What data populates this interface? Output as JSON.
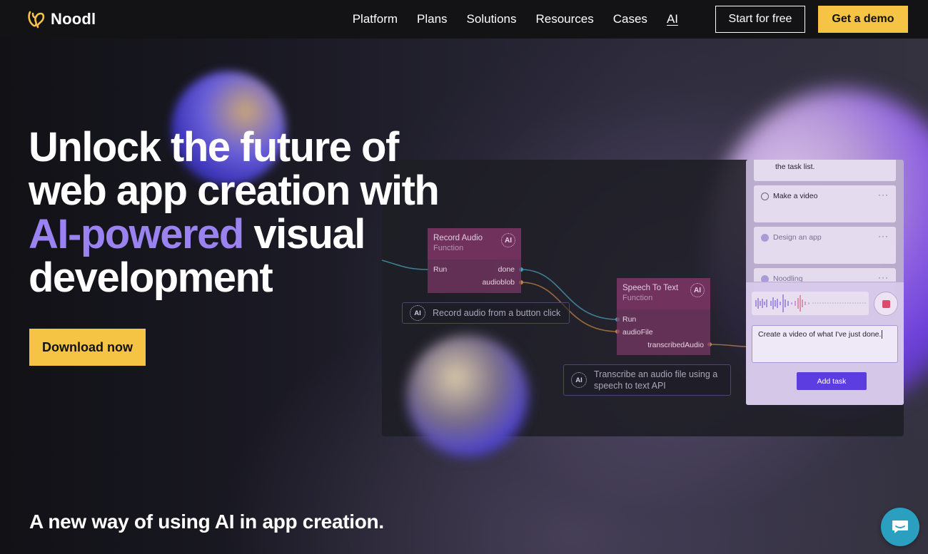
{
  "brand": {
    "name": "Noodl",
    "logo_color": "#f6c445"
  },
  "nav": {
    "links": [
      "Platform",
      "Plans",
      "Solutions",
      "Resources",
      "Cases",
      "AI"
    ],
    "start_label": "Start for free",
    "demo_label": "Get a demo"
  },
  "hero": {
    "line1_a": "Unlock ",
    "line1_b": "the future of",
    "line2": "web app creation with",
    "line3_accent": "AI-powered",
    "line3_rest": " visual",
    "line4": "development",
    "cta_label": "Download now",
    "tagline": "A new way of using AI in app creation."
  },
  "editor": {
    "node_record": {
      "title": "Record Audio",
      "subtitle": "Function",
      "badge": "AI",
      "port_run": "Run",
      "port_done": "done",
      "port_audioblob": "audioblob"
    },
    "node_speech": {
      "title": "Speech To Text",
      "subtitle": "Function",
      "badge": "AI",
      "port_run": "Run",
      "port_audiofile": "audioFile",
      "port_transcribed": "transcribedAudio"
    },
    "comment1": {
      "badge": "AI",
      "text": "Record audio from a button click"
    },
    "comment2": {
      "badge": "AI",
      "text_line1": "Transcribe an audio file using a",
      "text_line2": "speech to text API"
    }
  },
  "task_app": {
    "top_text": "the task list.",
    "tasks": [
      {
        "label": "Make a video",
        "done": false
      },
      {
        "label": "Design an app",
        "done": true
      },
      {
        "label": "Noodling",
        "done": true
      }
    ],
    "menu_glyph": "···",
    "input_value": "Create a video of what I've just done.",
    "add_label": "Add task",
    "record_color": "#e04a6a"
  },
  "colors": {
    "accent_purple": "#9a82f0",
    "cta_yellow": "#f6c445",
    "chat_blue": "#2a9fbf"
  }
}
